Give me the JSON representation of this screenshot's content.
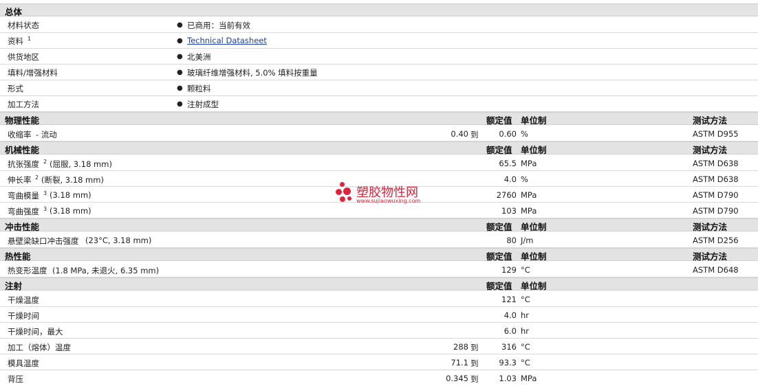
{
  "general": {
    "title": "总体",
    "rows": [
      {
        "label": "材料状态",
        "value": "已商用：当前有效"
      },
      {
        "label": "资料",
        "sup": "1",
        "value": "Technical Datasheet"
      },
      {
        "label": "供货地区",
        "value": "北美洲"
      },
      {
        "label": "填料/增强材料",
        "value": "玻璃纤维增强材料, 5.0% 填料按重量"
      },
      {
        "label": "形式",
        "value": "颗粒料"
      },
      {
        "label": "加工方法",
        "value": "注射成型"
      }
    ]
  },
  "headers": {
    "rated": "额定值",
    "unit": "单位制",
    "test": "测试方法"
  },
  "range_word": "到",
  "physical": {
    "title": "物理性能",
    "rows": [
      {
        "label": "收缩率",
        "qual": " - 流动",
        "low": "0.40",
        "high": "0.60",
        "unit": "%",
        "test": "ASTM D955"
      }
    ]
  },
  "mechanical": {
    "title": "机械性能",
    "rows": [
      {
        "label": "抗张强度",
        "sup": "2",
        "qual": "(屈服, 3.18 mm)",
        "value": "65.5",
        "unit": "MPa",
        "test": "ASTM D638"
      },
      {
        "label": "伸长率",
        "sup": "2",
        "qual": "(断裂, 3.18 mm)",
        "value": "4.0",
        "unit": "%",
        "test": "ASTM D638"
      },
      {
        "label": "弯曲模量",
        "sup": "3",
        "qual": "(3.18 mm)",
        "value": "2760",
        "unit": "MPa",
        "test": "ASTM D790"
      },
      {
        "label": "弯曲强度",
        "sup": "3",
        "qual": "(3.18 mm)",
        "value": "103",
        "unit": "MPa",
        "test": "ASTM D790"
      }
    ]
  },
  "impact": {
    "title": "冲击性能",
    "rows": [
      {
        "label": "悬壁梁缺口冲击强度",
        "qual": "(23°C, 3.18 mm)",
        "value": "80",
        "unit": "J/m",
        "test": "ASTM D256"
      }
    ]
  },
  "thermal": {
    "title": "热性能",
    "rows": [
      {
        "label": "热变形温度",
        "qual": "(1.8 MPa, 未退火, 6.35 mm)",
        "value": "129",
        "unit": "°C",
        "test": "ASTM D648"
      }
    ]
  },
  "injection": {
    "title": "注射",
    "rows": [
      {
        "label": "干燥温度",
        "value": "121",
        "unit": "°C"
      },
      {
        "label": "干燥时间",
        "value": "4.0",
        "unit": "hr"
      },
      {
        "label": "干燥时间，最大",
        "value": "6.0",
        "unit": "hr"
      },
      {
        "label": "加工（熔体）温度",
        "low": "288",
        "high": "316",
        "unit": "°C"
      },
      {
        "label": "模具温度",
        "low": "71.1",
        "high": "93.3",
        "unit": "°C"
      },
      {
        "label": "背压",
        "low": "0.345",
        "high": "1.03",
        "unit": "MPa"
      }
    ]
  },
  "watermark": {
    "text": "塑胶物性网",
    "url": "www.sujiaowuxing.com",
    "color": "#e0233a"
  }
}
